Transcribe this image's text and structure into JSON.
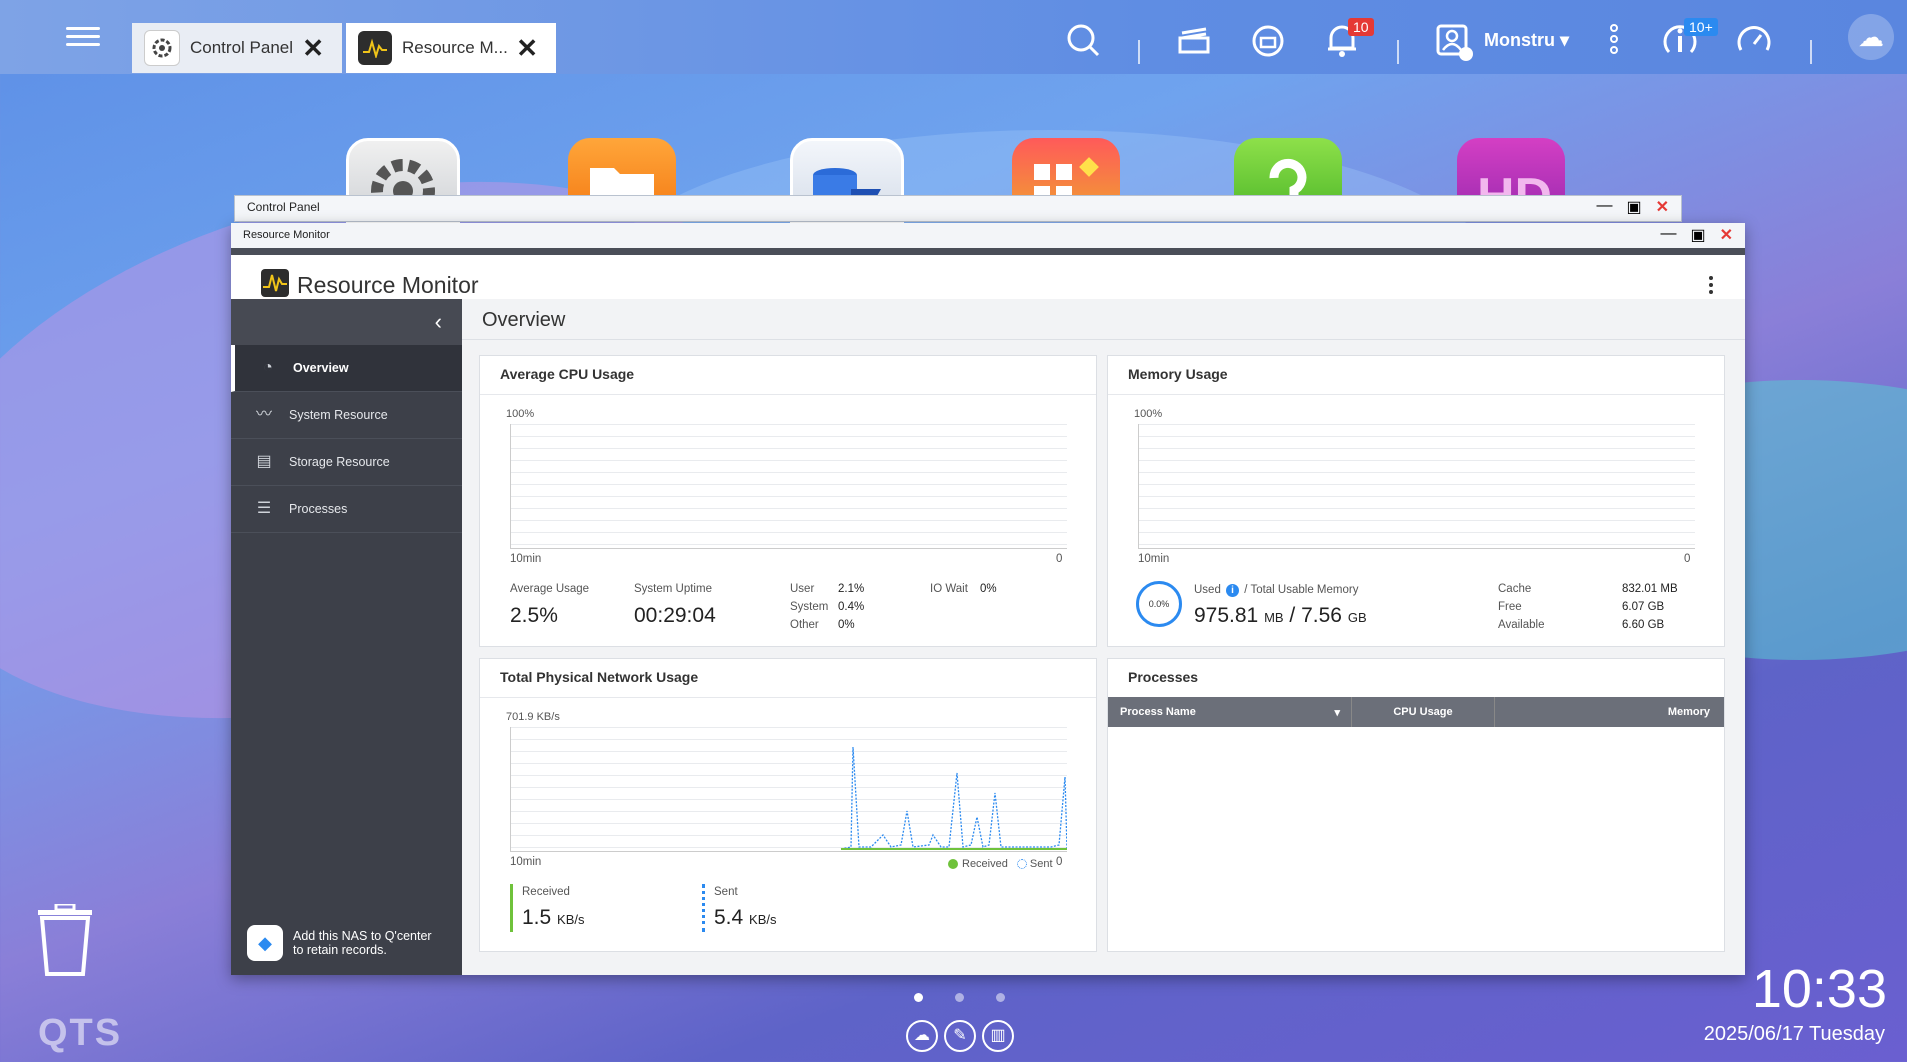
{
  "taskbar": {
    "tabs": [
      {
        "label": "Control Panel"
      },
      {
        "label": "Resource M..."
      }
    ],
    "notifications_badge": "10",
    "user_name": "Monstru",
    "updates_badge": "10+"
  },
  "desktop": {
    "icons": [
      "gear-app-icon",
      "file-station-icon",
      "storage-icon",
      "app-center-icon",
      "help-icon",
      "hd-station-icon"
    ]
  },
  "control_panel_window": {
    "title": "Control Panel"
  },
  "resource_monitor": {
    "window_title": "Resource Monitor",
    "app_title": "Resource Monitor",
    "sidebar": {
      "items": [
        {
          "label": "Overview"
        },
        {
          "label": "System Resource"
        },
        {
          "label": "Storage Resource"
        },
        {
          "label": "Processes"
        }
      ],
      "qcenter_line1": "Add this NAS to Q'center",
      "qcenter_line2": "to retain records."
    },
    "overview_title": "Overview",
    "cpu": {
      "title": "Average CPU Usage",
      "y_max": "100%",
      "x_left": "10min",
      "x_right": "0",
      "avg_label": "Average Usage",
      "avg_value": "2.5%",
      "uptime_label": "System Uptime",
      "uptime_value": "00:29:04",
      "user_label": "User",
      "user_value": "2.1%",
      "system_label": "System",
      "system_value": "0.4%",
      "other_label": "Other",
      "other_value": "0%",
      "iowait_label": "IO Wait",
      "iowait_value": "0%"
    },
    "memory": {
      "title": "Memory Usage",
      "y_max": "100%",
      "x_left": "10min",
      "x_right": "0",
      "ring_value": "0.0%",
      "used_label": "Used",
      "total_label": "/ Total Usable Memory",
      "used_value": "975.81",
      "used_unit": "MB",
      "sep": "/",
      "total_value": "7.56",
      "total_unit": "GB",
      "cache_label": "Cache",
      "cache_value": "832.01 MB",
      "free_label": "Free",
      "free_value": "6.07 GB",
      "available_label": "Available",
      "available_value": "6.60 GB"
    },
    "network": {
      "title": "Total Physical Network Usage",
      "y_max": "701.9 KB/s",
      "x_left": "10min",
      "x_right": "0",
      "legend_received": "Received",
      "legend_sent": "Sent",
      "received_label": "Received",
      "received_value": "1.5",
      "received_unit": "KB/s",
      "sent_label": "Sent",
      "sent_value": "5.4",
      "sent_unit": "KB/s"
    },
    "processes": {
      "title": "Processes",
      "columns": [
        "Process Name",
        "CPU Usage",
        "Memory"
      ]
    }
  },
  "desktop_footer": {
    "brand": "QTS",
    "time": "10:33",
    "date": "2025/06/17 Tuesday"
  },
  "colors": {
    "accent": "#2b8af0",
    "sidebar": "#3d4049",
    "received": "#6fc23b",
    "sent": "#2b8af0",
    "badge": "#e53935"
  }
}
